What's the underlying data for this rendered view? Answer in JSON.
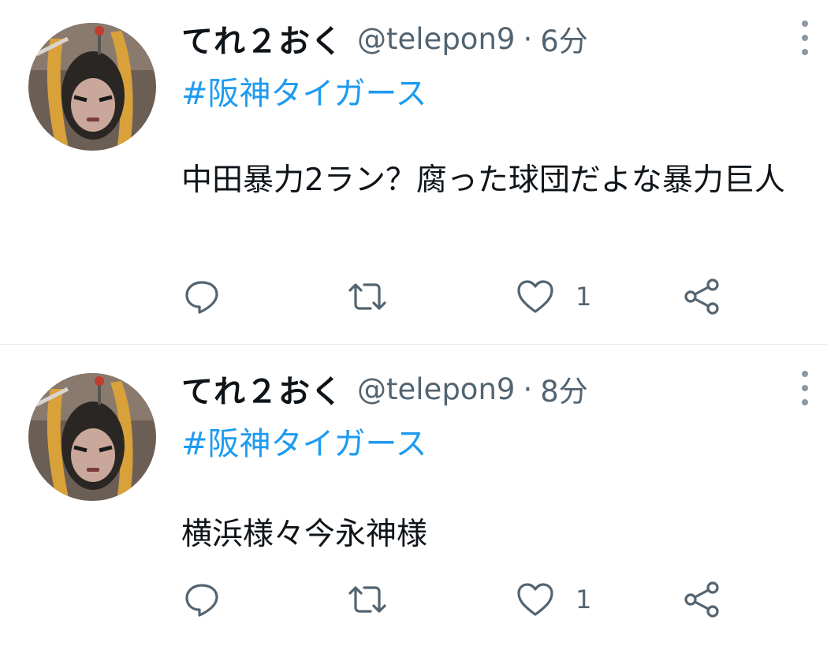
{
  "tweets": [
    {
      "display_name": "てれ２おく",
      "handle": "@telepon9",
      "separator": "·",
      "time": "6分",
      "hashtag": "#阪神タイガース",
      "text": "中田暴力2ラン？腐った球団だよな暴力巨人",
      "like_count": "1"
    },
    {
      "display_name": "てれ２おく",
      "handle": "@telepon9",
      "separator": "·",
      "time": "8分",
      "hashtag": "#阪神タイガース",
      "text": "横浜様々今永神様",
      "like_count": "1"
    }
  ],
  "icons": {
    "reply": "reply-icon",
    "retweet": "retweet-icon",
    "like": "heart-icon",
    "share": "share-icon",
    "more": "more-vertical-icon"
  },
  "colors": {
    "hashtag": "#1d9bf0",
    "secondary_text": "#536471",
    "icon": "#536471",
    "divider": "#e6ecf0"
  }
}
